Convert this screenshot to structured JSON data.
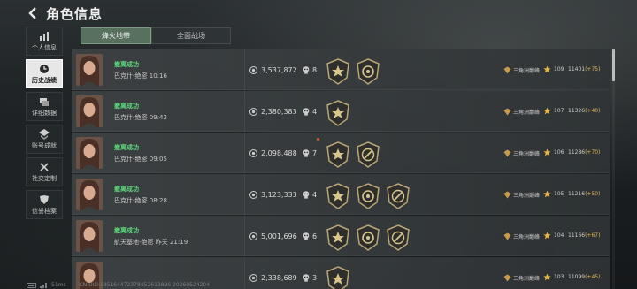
{
  "header": {
    "title": "角色信息"
  },
  "sidebar": {
    "items": [
      {
        "label": "个人信息",
        "icon": "bar-chart-icon",
        "active": false
      },
      {
        "label": "历史战绩",
        "icon": "clock-icon",
        "active": true
      },
      {
        "label": "详细数据",
        "icon": "data-cards-icon",
        "active": false
      },
      {
        "label": "账号成就",
        "icon": "achievement-icon",
        "active": false
      },
      {
        "label": "社交定制",
        "icon": "tools-icon",
        "active": false
      },
      {
        "label": "信誉档案",
        "icon": "shield-icon",
        "active": false
      }
    ]
  },
  "tabs": [
    {
      "label": "烽火地带",
      "active": true
    },
    {
      "label": "全面战场",
      "active": false
    }
  ],
  "records": [
    {
      "status": "撤离成功",
      "location": "巴克什-绝密 10:16",
      "coins": "3,537,872",
      "kills": "8",
      "badges": [
        "badge-star",
        "badge-emblem"
      ],
      "rank": "三角洲巅峰",
      "level": "109",
      "score": "11401",
      "delta": "(+75)",
      "new_dot": false
    },
    {
      "status": "撤离成功",
      "location": "巴克什-绝密 09:42",
      "coins": "2,380,383",
      "kills": "4",
      "badges": [
        "badge-star"
      ],
      "rank": "三角洲巅峰",
      "level": "107",
      "score": "11326",
      "delta": "(+40)",
      "new_dot": false
    },
    {
      "status": "撤离成功",
      "location": "巴克什-绝密 09:05",
      "coins": "2,098,488",
      "kills": "7",
      "badges": [
        "badge-star",
        "badge-slash"
      ],
      "rank": "三角洲巅峰",
      "level": "106",
      "score": "11286",
      "delta": "(+70)",
      "new_dot": true
    },
    {
      "status": "撤离成功",
      "location": "巴克什-绝密 08:28",
      "coins": "3,123,333",
      "kills": "4",
      "badges": [
        "badge-star",
        "badge-emblem",
        "badge-slash"
      ],
      "rank": "三角洲巅峰",
      "level": "105",
      "score": "11216",
      "delta": "(+50)",
      "new_dot": false
    },
    {
      "status": "撤离成功",
      "location": "航天基地-绝密 昨天 21:19",
      "coins": "5,001,696",
      "kills": "6",
      "badges": [
        "badge-star",
        "badge-emblem",
        "badge-slash"
      ],
      "rank": "三角洲巅峰",
      "level": "104",
      "score": "11166",
      "delta": "(+67)",
      "new_dot": false
    },
    {
      "status": "",
      "location": "",
      "coins": "2,338,689",
      "kills": "3",
      "badges": [
        "badge-star"
      ],
      "rank": "三角洲巅峰",
      "level": "103",
      "score": "11099",
      "delta": "(+45)",
      "new_dot": false
    }
  ],
  "footer": {
    "ping": "51ms",
    "uid": "CN UID:18516447237845261389S 20260524204"
  },
  "colors": {
    "success_green": "#5ed67d",
    "active_tab": "#58705e",
    "delta_gold": "#e6b547"
  }
}
